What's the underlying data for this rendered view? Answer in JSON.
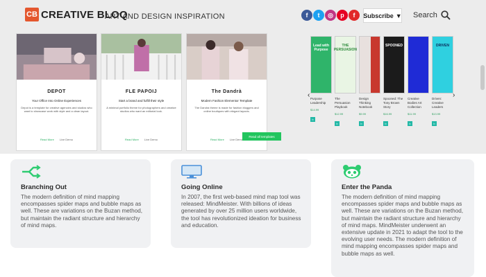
{
  "header": {
    "logo_badge": "CB",
    "logo_text": "CREATIVE BLOQ",
    "tagline": "ART AND DESIGN INSPIRATION",
    "socials": [
      {
        "icon": "facebook-icon",
        "glyph": "f",
        "color": "#3b5998"
      },
      {
        "icon": "twitter-icon",
        "glyph": "t",
        "color": "#1da1f2"
      },
      {
        "icon": "instagram-icon",
        "glyph": "◎",
        "color": "#c13584"
      },
      {
        "icon": "pinterest-icon",
        "glyph": "p",
        "color": "#e60023"
      },
      {
        "icon": "flipboard-icon",
        "glyph": "f",
        "color": "#e12828"
      }
    ],
    "subscribe_label": "Subscribe",
    "search_label": "Search"
  },
  "hero_cards": [
    {
      "title": "DEPOT",
      "subtitle": "Your Office Into Online Experiences",
      "body": "Depot is a template for creative agencies and studios who want to showcase work with style and a clean layout.",
      "link1": "Read More",
      "link2": "Live Demo",
      "img": "#8c7f86"
    },
    {
      "title": "FLE PAPOIJ",
      "subtitle": "Start a brand and fulfill their style",
      "body": "A minimal portfolio theme for photographers and creative studios who want an editorial look.",
      "link1": "Read More",
      "link2": "Live Demo",
      "img": "#b48aa1"
    },
    {
      "title": "The Dandrà",
      "subtitle": "Modern Fashion Elementor Template",
      "body": "The Dandra theme is made for fashion bloggers and online boutiques with elegant layouts.",
      "link1": "Read More",
      "link2": "Live Demo",
      "img": "#c7b9b6"
    }
  ],
  "green_cta": "Read all templates",
  "books": [
    {
      "cover": "Lead with Purpose",
      "color": "#2fb46a",
      "text_color": "#ffffff",
      "title": "Purpose Leadership",
      "price": "$14.99"
    },
    {
      "cover": "THE PERSUASION",
      "color": "#e9f5e4",
      "text_color": "#2c8a3a",
      "title": "The Persuasion Playbook",
      "price": "$12.99"
    },
    {
      "cover": "",
      "color": "#e8e0de",
      "text_color": "#ffffff",
      "title": "Design Thinking Notebook",
      "price": "$9.99"
    },
    {
      "cover": "SPOONED",
      "color": "#1b1b1b",
      "text_color": "#ffffff",
      "title": "Spooned: The Tony Brown Story",
      "price": "$16.99"
    },
    {
      "cover": "",
      "color": "#1f2bd6",
      "text_color": "#ffffff",
      "title": "Creative Bodies Art Collection",
      "price": "$11.99"
    },
    {
      "cover": "DRIVEN",
      "color": "#2fd0e0",
      "text_color": "#0a2a5a",
      "title": "Driven: Creative Leaders",
      "price": "$13.99"
    }
  ],
  "features": [
    {
      "icon": "branching-icon",
      "title": "Branching Out",
      "text": "The modern definition of mind mapping encompasses spider maps and bubble maps as well. These are variations on the Buzan method, but maintain the radiant structure and hierarchy of mind maps."
    },
    {
      "icon": "monitor-icon",
      "title": "Going Online",
      "text": "In 2007, the first web-based mind map tool was released: MindMeister. With billions of ideas generated by over 25 million users worldwide, the tool has revolutionized ideation for business and education."
    },
    {
      "icon": "panda-icon",
      "title": "Enter the Panda",
      "text": "The modern definition of mind mapping encompasses spider maps and bubble maps as well. These are variations on the Buzan method, but maintain the radiant structure and hierarchy of mind maps. MindMeister underwent an extensive update in 2021 to adapt the tool to the evolving user needs. The modern definition of mind mapping encompasses spider maps and bubble maps as well."
    }
  ],
  "colors": {
    "accent": "#22c55e",
    "logo": "#e4572e",
    "icon": "#2ecc71"
  }
}
